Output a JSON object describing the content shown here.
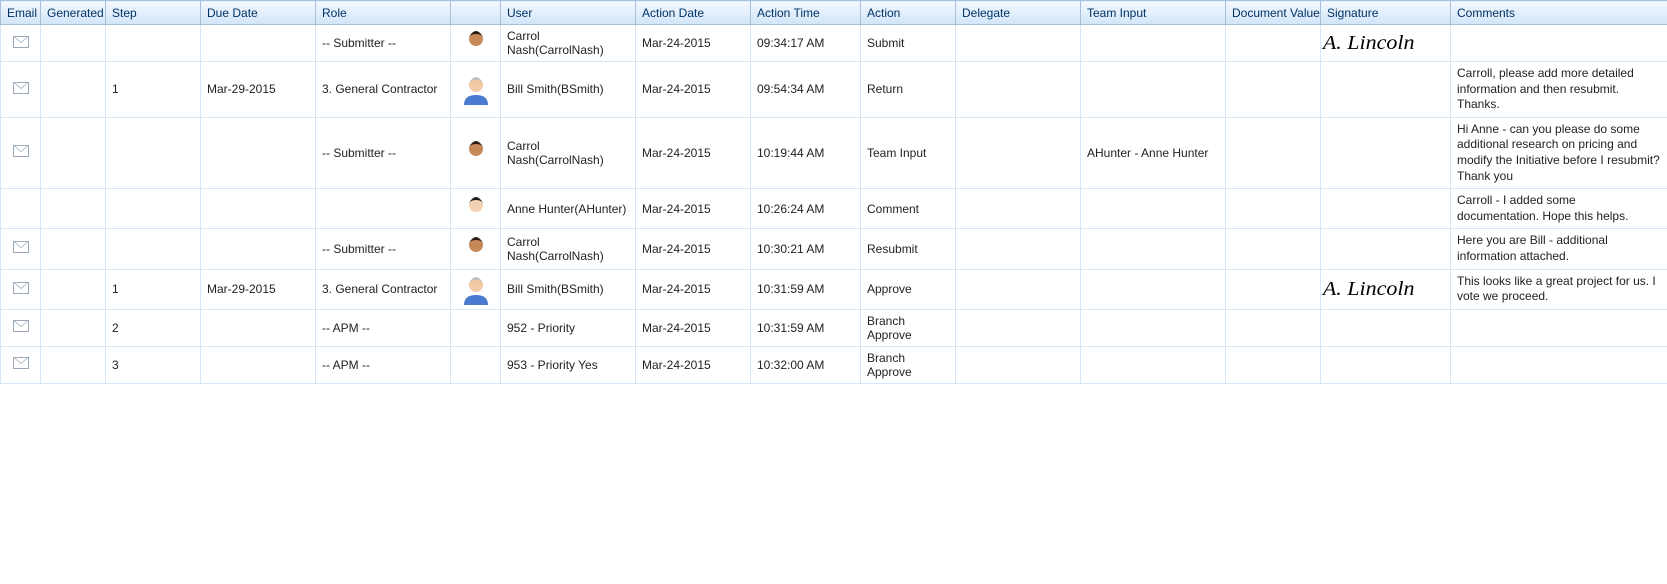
{
  "columns": {
    "email": "Email",
    "generated": "Generated",
    "step": "Step",
    "due_date": "Due Date",
    "role": "Role",
    "avatar": "",
    "user": "User",
    "action_date": "Action Date",
    "action_time": "Action Time",
    "action": "Action",
    "delegate": "Delegate",
    "team_input": "Team Input",
    "document_value": "Document Value",
    "signature": "Signature",
    "comments": "Comments"
  },
  "avatars": {
    "carrol": "carrol-nash",
    "bill": "bill-smith",
    "anne": "anne-hunter"
  },
  "signature_text": "A. Lincoln",
  "rows": [
    {
      "has_email": true,
      "generated": "",
      "step": "",
      "due_date": "",
      "role": "-- Submitter --",
      "avatar": "carrol",
      "user": "Carrol Nash(CarrolNash)",
      "action_date": "Mar-24-2015",
      "action_time": "09:34:17 AM",
      "action": "Submit",
      "delegate": "",
      "team_input": "",
      "document_value": "",
      "has_signature": true,
      "comments": ""
    },
    {
      "has_email": true,
      "generated": "",
      "step": "1",
      "due_date": "Mar-29-2015",
      "role": "3. General Contractor",
      "avatar": "bill",
      "user": "Bill Smith(BSmith)",
      "action_date": "Mar-24-2015",
      "action_time": "09:54:34 AM",
      "action": "Return",
      "delegate": "",
      "team_input": "",
      "document_value": "",
      "has_signature": false,
      "comments": "Carroll, please add more detailed information and then resubmit. Thanks."
    },
    {
      "has_email": true,
      "generated": "",
      "step": "",
      "due_date": "",
      "role": "-- Submitter --",
      "avatar": "carrol",
      "user": "Carrol Nash(CarrolNash)",
      "action_date": "Mar-24-2015",
      "action_time": "10:19:44 AM",
      "action": "Team Input",
      "delegate": "",
      "team_input": "AHunter - Anne Hunter",
      "document_value": "",
      "has_signature": false,
      "comments": "Hi Anne - can you please do some additional research on pricing and modify the Initiative before I resubmit? Thank you"
    },
    {
      "has_email": false,
      "generated": "",
      "step": "",
      "due_date": "",
      "role": "",
      "avatar": "anne",
      "user": "Anne Hunter(AHunter)",
      "action_date": "Mar-24-2015",
      "action_time": "10:26:24 AM",
      "action": "Comment",
      "delegate": "",
      "team_input": "",
      "document_value": "",
      "has_signature": false,
      "comments": "Carroll - I added some documentation. Hope this helps."
    },
    {
      "has_email": true,
      "generated": "",
      "step": "",
      "due_date": "",
      "role": "-- Submitter --",
      "avatar": "carrol",
      "user": "Carrol Nash(CarrolNash)",
      "action_date": "Mar-24-2015",
      "action_time": "10:30:21 AM",
      "action": "Resubmit",
      "delegate": "",
      "team_input": "",
      "document_value": "",
      "has_signature": false,
      "comments": "Here you are Bill - additional information attached."
    },
    {
      "has_email": true,
      "generated": "",
      "step": "1",
      "due_date": "Mar-29-2015",
      "role": "3. General Contractor",
      "avatar": "bill",
      "user": "Bill Smith(BSmith)",
      "action_date": "Mar-24-2015",
      "action_time": "10:31:59 AM",
      "action": "Approve",
      "delegate": "",
      "team_input": "",
      "document_value": "",
      "has_signature": true,
      "comments": "This looks like a great project for us. I vote we proceed."
    },
    {
      "has_email": true,
      "generated": "",
      "step": "2",
      "due_date": "",
      "role": "-- APM --",
      "avatar": "",
      "user": "952 - Priority",
      "action_date": "Mar-24-2015",
      "action_time": "10:31:59 AM",
      "action": "Branch Approve",
      "delegate": "",
      "team_input": "",
      "document_value": "",
      "has_signature": false,
      "comments": ""
    },
    {
      "has_email": true,
      "generated": "",
      "step": "3",
      "due_date": "",
      "role": "-- APM --",
      "avatar": "",
      "user": "953 - Priority Yes",
      "action_date": "Mar-24-2015",
      "action_time": "10:32:00 AM",
      "action": "Branch Approve",
      "delegate": "",
      "team_input": "",
      "document_value": "",
      "has_signature": false,
      "comments": ""
    }
  ]
}
